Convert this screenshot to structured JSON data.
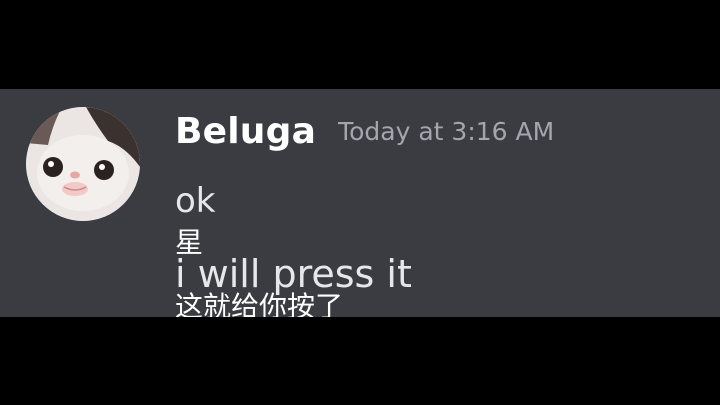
{
  "message": {
    "author": "Beluga",
    "timestamp": "Today at 3:16 AM",
    "lines": [
      "ok",
      "星",
      "i will press it",
      "这就给你按了"
    ],
    "avatar_icon": "cat-avatar-icon"
  },
  "colors": {
    "background": "#000000",
    "message_band": "#3a3c42",
    "username": "#ffffff",
    "timestamp": "#a3a6ad",
    "text": "#e6e7ea"
  }
}
